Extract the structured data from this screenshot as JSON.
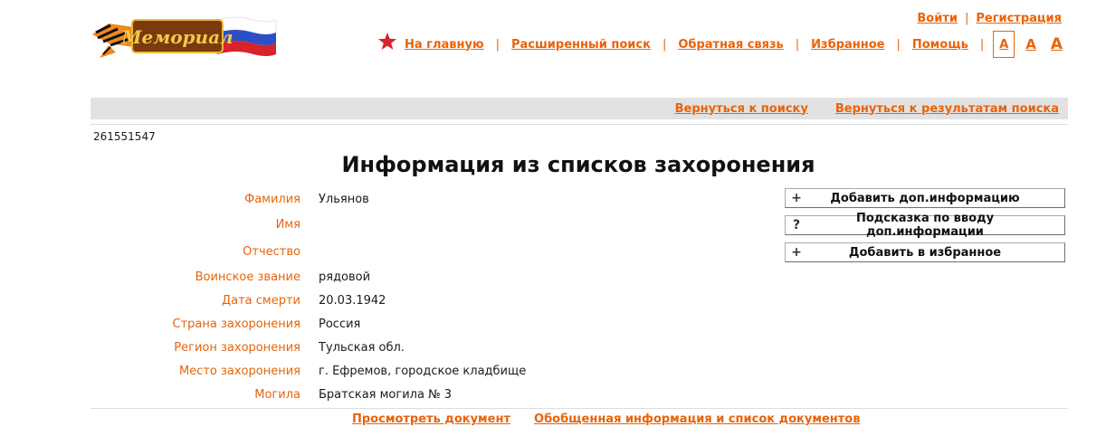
{
  "logo": {
    "text": "Мемориал"
  },
  "auth": {
    "login": "Войти",
    "separator": "|",
    "register": "Регистрация"
  },
  "nav": {
    "items": [
      {
        "label": "На главную"
      },
      {
        "label": "Расширенный поиск"
      },
      {
        "label": "Обратная связь"
      },
      {
        "label": "Избранное"
      },
      {
        "label": "Помощь"
      }
    ],
    "separator": "|",
    "font_sizes": [
      "A",
      "A",
      "A"
    ]
  },
  "backbar": {
    "back_to_search": "Вернуться к поиску",
    "back_to_results": "Вернуться к результатам поиска"
  },
  "record_id": "261551547",
  "title": "Информация из списков захоронения",
  "fields": [
    {
      "label": "Фамилия",
      "value": "Ульянов"
    },
    {
      "label": "Имя",
      "value": ""
    },
    {
      "label": "Отчество",
      "value": ""
    },
    {
      "label": "Воинское звание",
      "value": "рядовой"
    },
    {
      "label": "Дата смерти",
      "value": "20.03.1942"
    },
    {
      "label": "Страна захоронения",
      "value": "Россия"
    },
    {
      "label": "Регион захоронения",
      "value": "Тульская обл."
    },
    {
      "label": "Место захоронения",
      "value": "г. Ефремов, городское кладбище"
    },
    {
      "label": "Могила",
      "value": "Братская могила № 3"
    }
  ],
  "actions": [
    {
      "icon": "+",
      "label": "Добавить доп.информацию"
    },
    {
      "icon": "?",
      "label": "Подсказка по вводу доп.информации"
    },
    {
      "icon": "+",
      "label": "Добавить в избранное"
    }
  ],
  "bottom_links": {
    "view_document": "Просмотреть документ",
    "summary": "Обобщенная информация и список документов"
  },
  "colors": {
    "accent": "#e8630a",
    "bar": "#e2e2e2",
    "star": "#d8232a"
  }
}
